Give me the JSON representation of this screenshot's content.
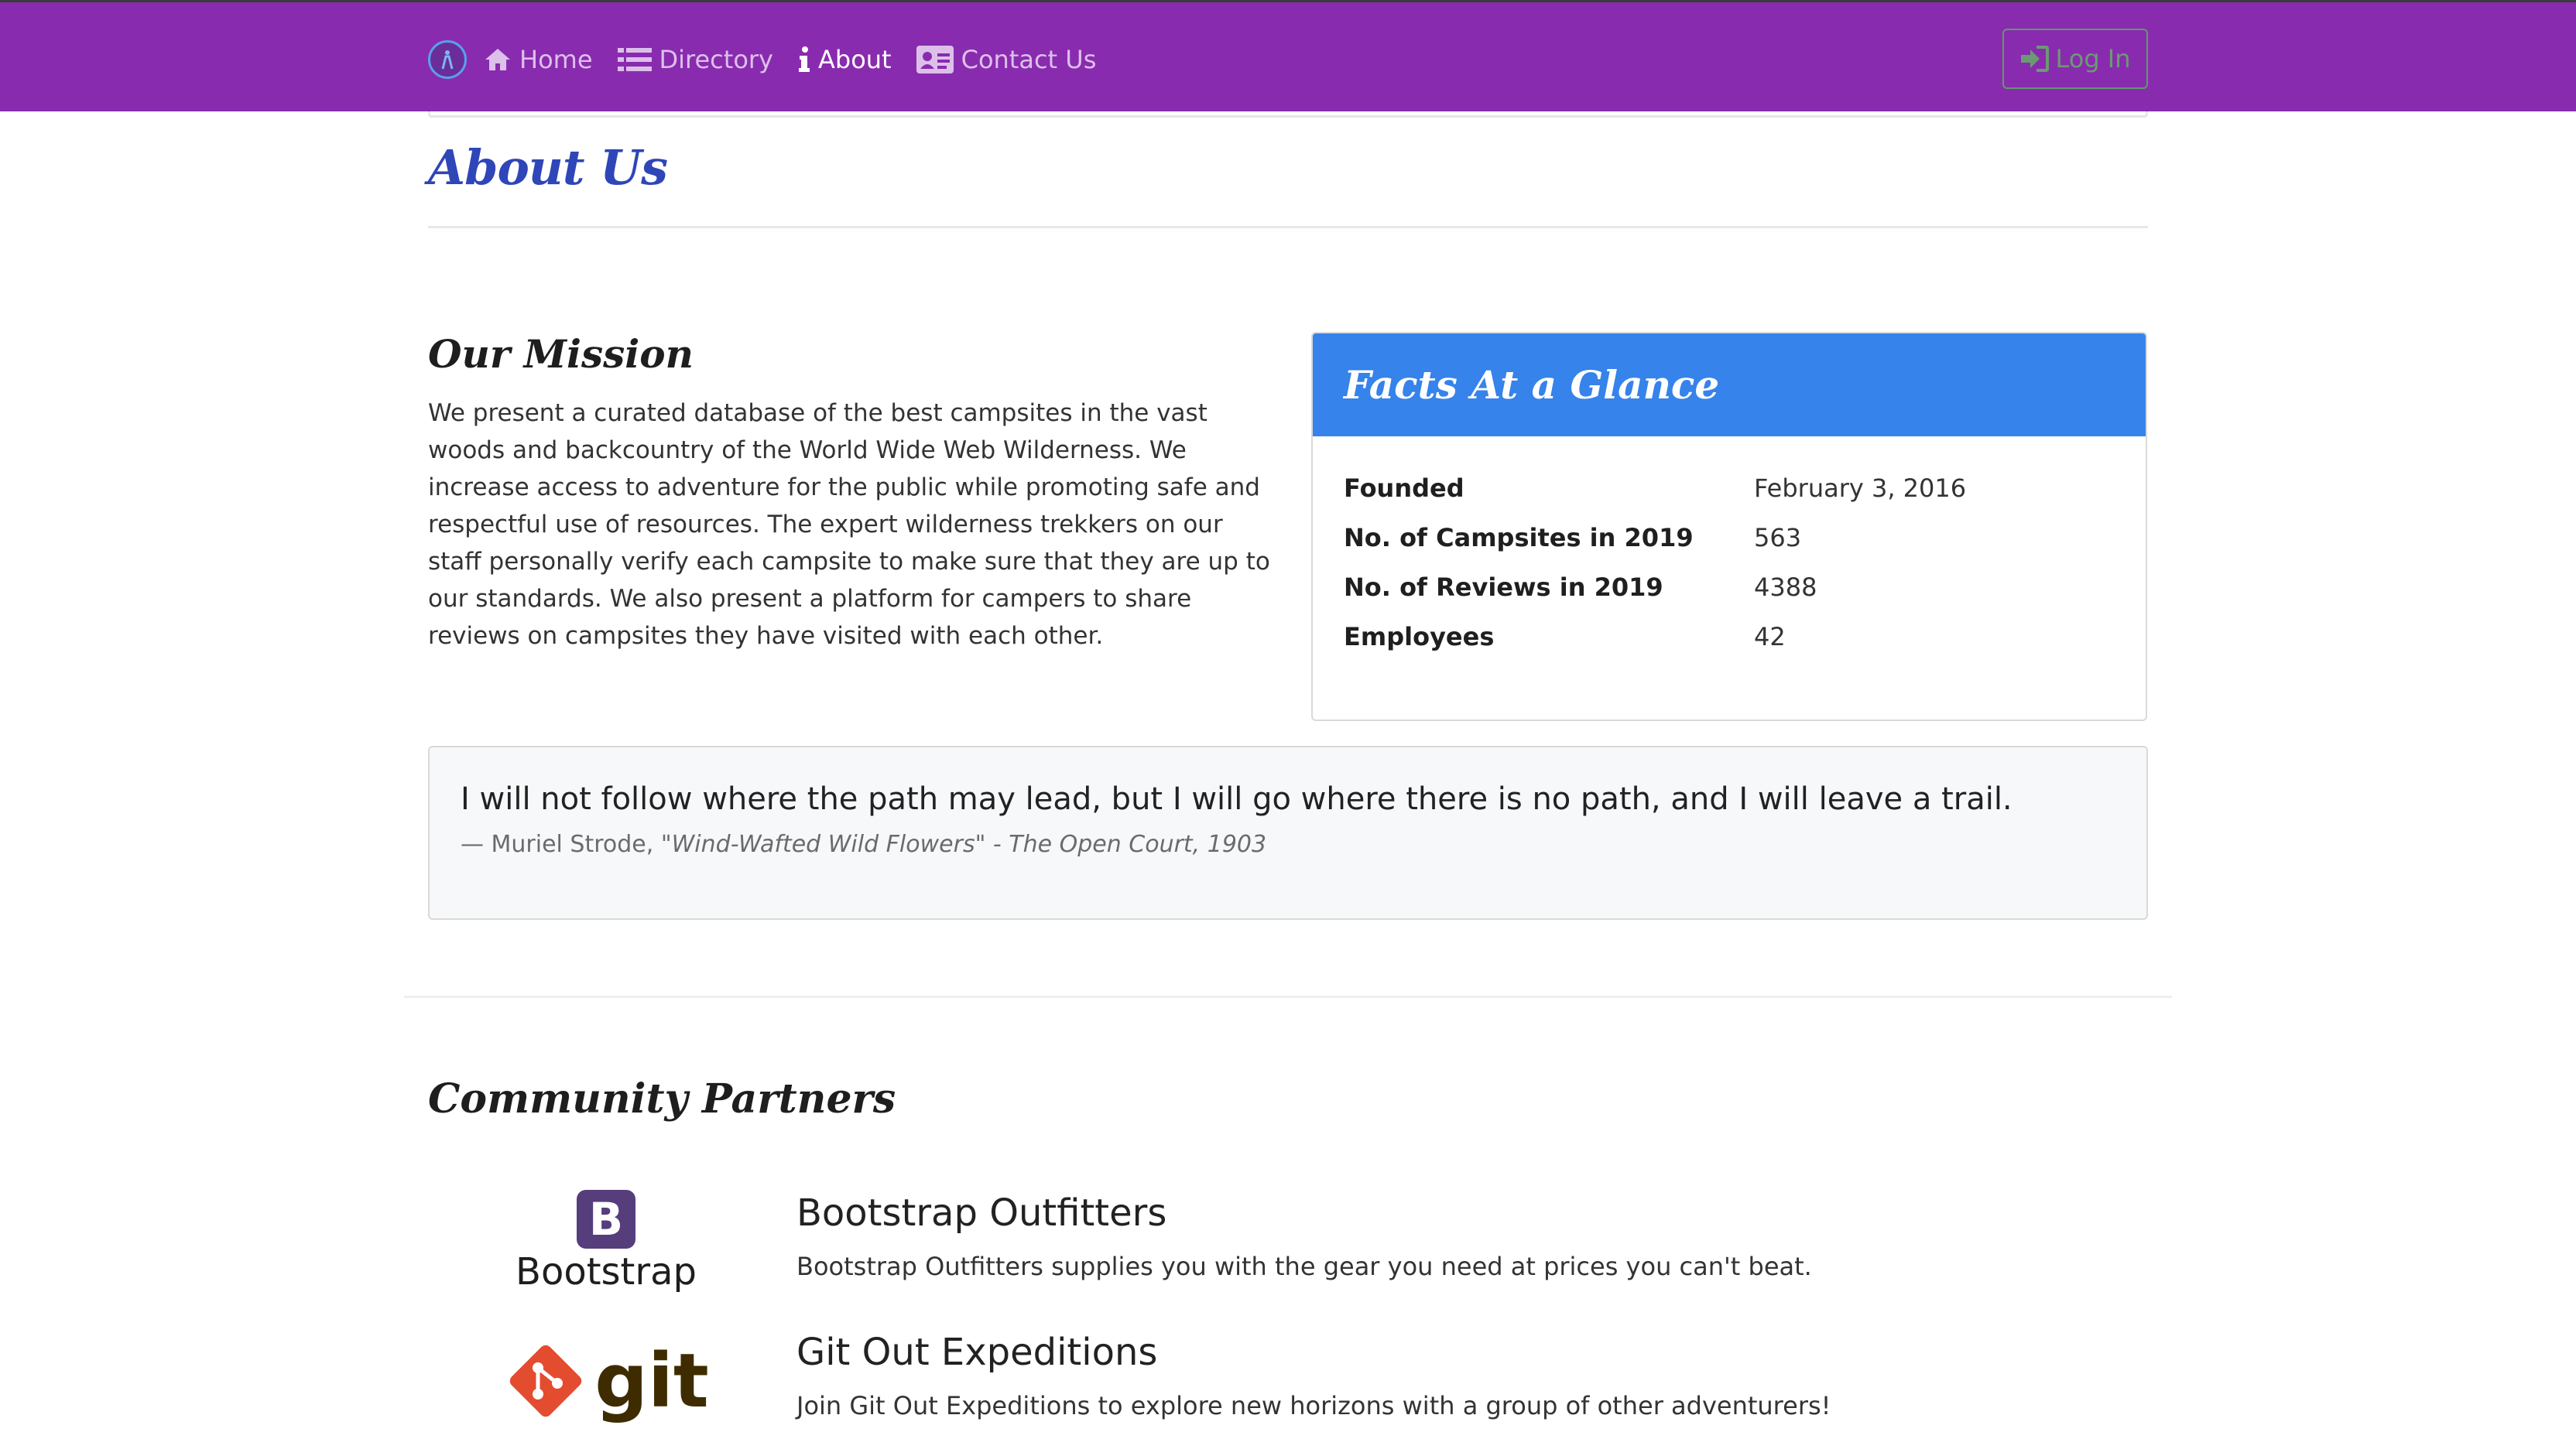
{
  "nav": {
    "items": [
      {
        "label": "Home",
        "icon": "home-icon"
      },
      {
        "label": "Directory",
        "icon": "list-icon"
      },
      {
        "label": "About",
        "icon": "info-icon"
      },
      {
        "label": "Contact Us",
        "icon": "address-card-icon"
      }
    ],
    "login_label": "Log In"
  },
  "page": {
    "title": "About Us"
  },
  "mission": {
    "heading": "Our Mission",
    "text": "We present a curated database of the best campsites in the vast woods and backcountry of the World Wide Web Wilderness. We increase access to adventure for the public while promoting safe and respectful use of resources. The expert wilderness trekkers on our staff personally verify each campsite to make sure that they are up to our standards. We also present a platform for campers to share reviews on campsites they have visited with each other."
  },
  "facts": {
    "heading": "Facts At a Glance",
    "rows": [
      {
        "label": "Founded",
        "value": "February 3, 2016"
      },
      {
        "label": "No. of Campsites in 2019",
        "value": "563"
      },
      {
        "label": "No. of Reviews in 2019",
        "value": "4388"
      },
      {
        "label": "Employees",
        "value": "42"
      }
    ]
  },
  "quote": {
    "text": "I will not follow where the path may lead, but I will go where there is no path, and I will leave a trail.",
    "author": "— Muriel Strode, ",
    "source": "\"Wind-Wafted Wild Flowers\" - The Open Court, 1903"
  },
  "partners": {
    "heading": "Community Partners",
    "items": [
      {
        "name": "Bootstrap Outfitters",
        "desc": "Bootstrap Outfitters supplies you with the gear you need at prices you can't beat.",
        "logo_text": "Bootstrap",
        "logo_letter": "B"
      },
      {
        "name": "Git Out Expeditions",
        "desc": "Join Git Out Expeditions to explore new horizons with a group of other adventurers!",
        "logo_text": "git"
      }
    ]
  },
  "colors": {
    "navbar": "#892baf",
    "title": "#2f46b8",
    "facts_header": "#3583eb"
  }
}
